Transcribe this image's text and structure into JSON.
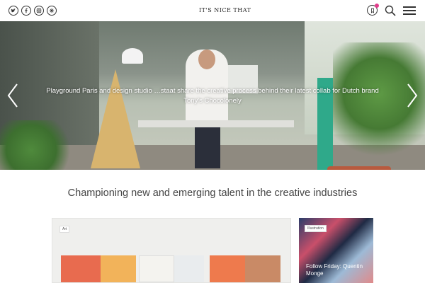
{
  "header": {
    "logo": "IT'S NICE THAT",
    "social_icons": [
      "twitter-icon",
      "facebook-icon",
      "instagram-icon",
      "pinterest-icon"
    ],
    "notification_color": "#e23c8c"
  },
  "hero": {
    "caption_line1": "Playground Paris and design studio …staat share the creative process behind their latest collab for Dutch brand",
    "caption_line2": "Tony's Chocolonely"
  },
  "tagline": "Championing new and emerging talent in the creative industries",
  "cards": [
    {
      "tag": "Art"
    },
    {
      "tag": "Illustration",
      "title": "Follow Friday: Quentin Monge"
    }
  ]
}
